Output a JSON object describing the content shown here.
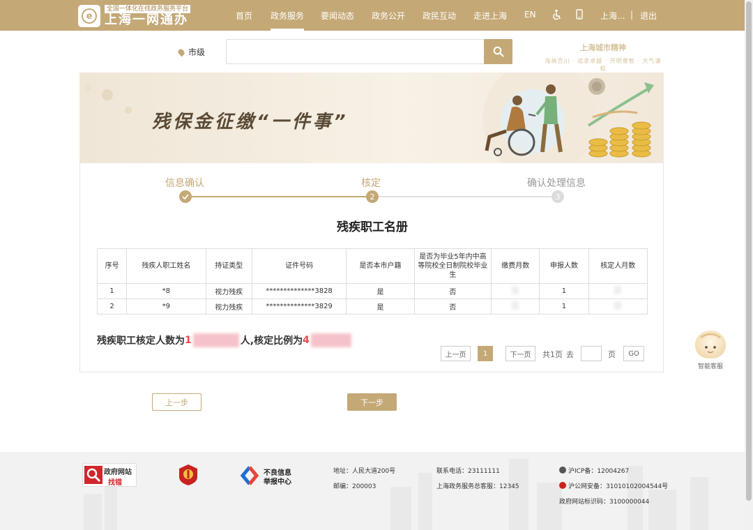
{
  "header": {
    "logo_sub": "全国一体化在线政务服务平台",
    "logo_main": "上海一网通办",
    "nav": [
      "首页",
      "政务服务",
      "要闻动态",
      "政务公开",
      "政民互动",
      "走进上海",
      "EN"
    ],
    "active_nav": "政务服务",
    "user": "上海...",
    "logout": "退出",
    "accent_color": "#c4a876"
  },
  "search": {
    "location": "市级",
    "placeholder": "",
    "slogan_title": "上海城市精神",
    "slogan_sub": "海纳百川 · 追求卓越 · 开明睿智 · 大气谦和"
  },
  "banner": {
    "title": "残保金征缴“一件事”"
  },
  "steps": [
    {
      "label": "信息确认",
      "state": "done"
    },
    {
      "label": "核定",
      "number": "2",
      "state": "current"
    },
    {
      "label": "确认处理信息",
      "number": "3",
      "state": "pending"
    }
  ],
  "table": {
    "title": "残疾职工名册",
    "headers": [
      "序号",
      "残疾人职工姓名",
      "持证类型",
      "证件号码",
      "是否本市户籍",
      "是否为毕业5年内中高等院校全日制院校毕业生",
      "缴费月数",
      "申报人数",
      "核定人月数"
    ],
    "rows": [
      {
        "index": "1",
        "name": "*8",
        "cert_type": "视力残疾",
        "id_no": "**************3828",
        "local": "是",
        "graduate": "否",
        "months": "",
        "declared": "1",
        "approved": ""
      },
      {
        "index": "2",
        "name": "*9",
        "cert_type": "视力残疾",
        "id_no": "**************3829",
        "local": "是",
        "graduate": "否",
        "months": "",
        "declared": "1",
        "approved": ""
      }
    ]
  },
  "summary": {
    "prefix": "残疾职工核定人数为",
    "count_visible": "1",
    "middle": "人,核定比例为",
    "ratio_visible": "4"
  },
  "pagination": {
    "prev": "上一页",
    "current": "1",
    "next": "下一页",
    "total": "共1页",
    "goto": "去",
    "page_unit": "页",
    "go": "GO"
  },
  "actions": {
    "prev_step": "上一步",
    "next_step": "下一步"
  },
  "assistant": {
    "label": "智能客服"
  },
  "footer": {
    "gov_site_top": "政府网站",
    "gov_site_bottom": "找错",
    "report_top": "不良信息",
    "report_bottom": "举报中心",
    "address": "地址：人民大道200号",
    "postcode": "邮编：200003",
    "phone": "联系电话：23111111",
    "hotline": "上海政务服务总客服：12345",
    "icp": "沪ICP备：12004267",
    "security": "沪公网安备：31010102004544号",
    "site_code": "政府网站标识码：3100000044"
  }
}
